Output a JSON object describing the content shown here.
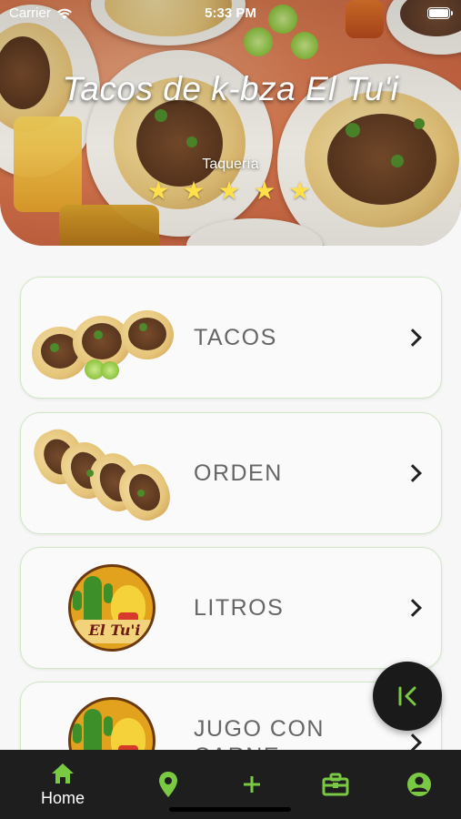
{
  "status_bar": {
    "carrier": "Carrier",
    "time": "5:33 PM",
    "battery_level": 1.0
  },
  "header": {
    "title": "Tacos de k-bza El Tu'i",
    "subtitle": "Taquería",
    "rating": 5,
    "stars": [
      "★",
      "★",
      "★",
      "★",
      "★"
    ],
    "star_color": "#ffe04a"
  },
  "menu": {
    "items": [
      {
        "label": "TACOS",
        "icon": "tacos-photo"
      },
      {
        "label": "ORDEN",
        "icon": "orden-photo"
      },
      {
        "label": "LITROS",
        "icon": "el-tui-logo"
      },
      {
        "label": "JUGO CON CARNE",
        "icon": "el-tui-logo"
      }
    ],
    "logo_text": "El Tu'i",
    "card_border_color": "#cfe8c4"
  },
  "fab": {
    "icon": "collapse-left-icon",
    "icon_color": "#7ac943"
  },
  "bottom_nav": {
    "accent_color": "#7ac943",
    "items": [
      {
        "label": "Home",
        "icon": "home-icon",
        "active": true
      },
      {
        "label": "",
        "icon": "location-pin-icon"
      },
      {
        "label": "",
        "icon": "plus-icon"
      },
      {
        "label": "",
        "icon": "briefcase-icon"
      },
      {
        "label": "",
        "icon": "account-icon"
      }
    ]
  }
}
